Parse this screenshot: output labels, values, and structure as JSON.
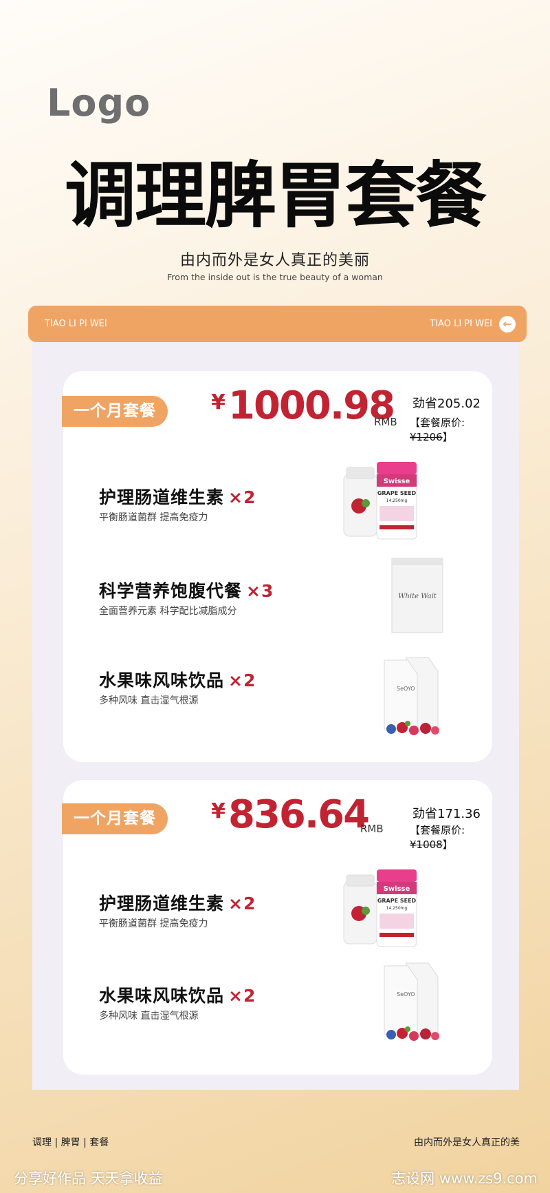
{
  "header": {
    "logo": "Logo",
    "title": "调理脾胃套餐",
    "subtitle": "由内而外是女人真正的美丽",
    "subtitle_en": "From the inside out is the true beauty of a woman"
  },
  "banner": {
    "left_text": "TIAO LI PI WEI",
    "right_text": "TIAO LI PI WEI",
    "arrow_icon": "arrow-left-icon"
  },
  "packages": [
    {
      "tag": "一个月套餐",
      "currency": "¥",
      "price": "1000.98",
      "unit": "RMB",
      "save_label": "劲省205.02",
      "orig_prefix": "【套餐原价:",
      "orig_value": "¥1206",
      "orig_suffix": "】",
      "items": [
        {
          "name": "护理肠道维生素",
          "mult": "×2",
          "desc": "平衡肠道菌群 提高免疫力"
        },
        {
          "name": "科学营养饱腹代餐",
          "mult": "×3",
          "desc": "全面营养元素 科学配比减脂成分"
        },
        {
          "name": "水果味风味饮品",
          "mult": "×2",
          "desc": "多种风味 直击湿气根源"
        }
      ]
    },
    {
      "tag": "一个月套餐",
      "currency": "¥",
      "price": "836.64",
      "unit": "RMB",
      "save_label": "劲省171.36",
      "orig_prefix": "【套餐原价:",
      "orig_value": "¥1008",
      "orig_suffix": "】",
      "items": [
        {
          "name": "护理肠道维生素",
          "mult": "×2",
          "desc": "平衡肠道菌群 提高免疫力"
        },
        {
          "name": "水果味风味饮品",
          "mult": "×2",
          "desc": "多种风味 直击湿气根源"
        }
      ]
    }
  ],
  "product_labels": {
    "bottle_brand": "Swisse",
    "bottle_name": "GRAPE SEED",
    "bottle_dose": "14,250mg",
    "pouch_text": "White Wait",
    "drink_brand": "SeOYO"
  },
  "footer": {
    "left": "调理 | 脾胃 | 套餐",
    "right": "由内而外是女人真正的美"
  },
  "watermark": {
    "left": "分享好作品 天天拿收益",
    "right": "志设网 www.zs9.com"
  },
  "colors": {
    "accent_orange": "#f0a464",
    "price_red": "#c22332",
    "panel": "#f1eef5"
  }
}
